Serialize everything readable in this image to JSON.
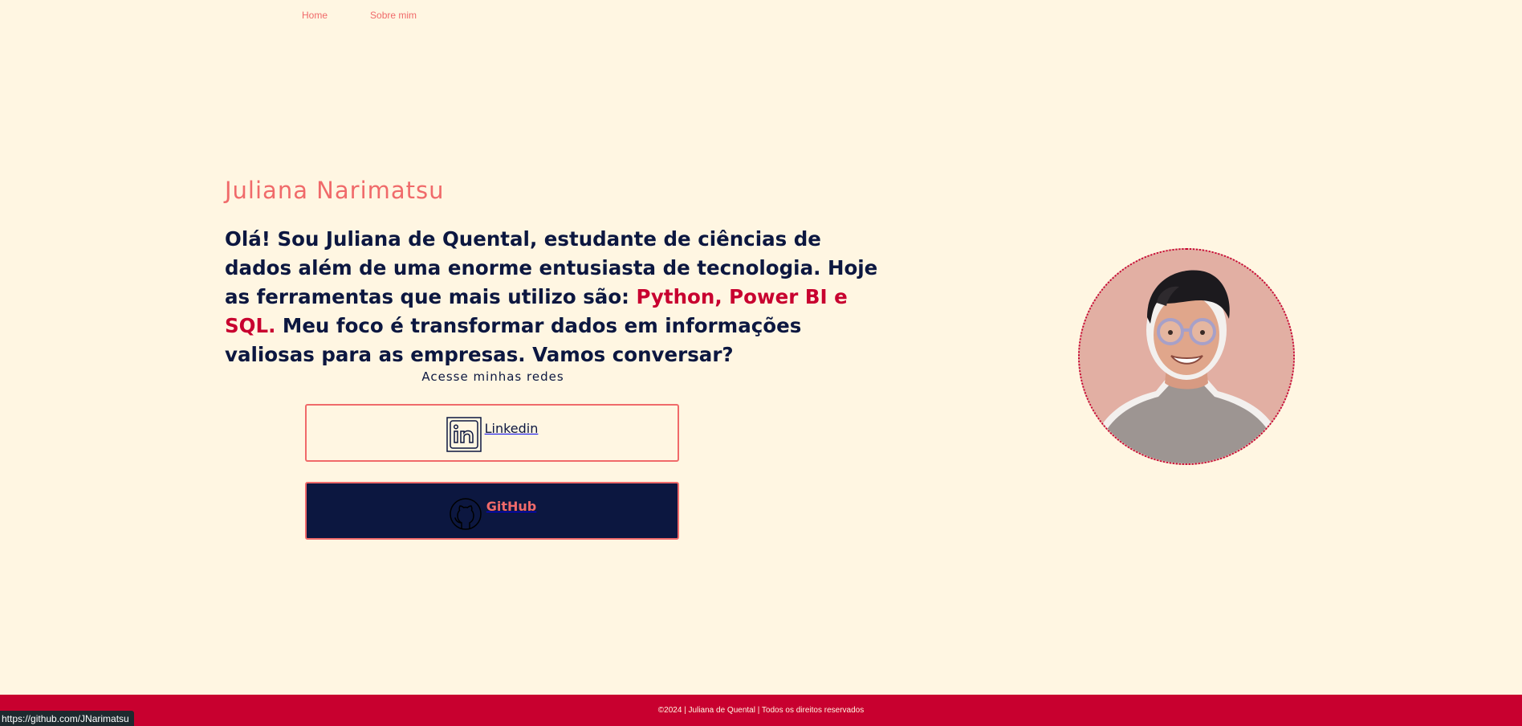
{
  "nav": {
    "home": "Home",
    "about": "Sobre mim"
  },
  "hero": {
    "name": "Juliana Narimatsu",
    "bio_part1": "Olá! Sou Juliana de Quental, estudante de ciências de dados além de uma enorme entusiasta de tecnologia. Hoje as ferramentas que mais utilizo são: ",
    "bio_highlight": "Python, Power BI e SQL.",
    "bio_part2": " Meu foco é transformar dados em informações valiosas para as empresas. Vamos conversar?"
  },
  "social": {
    "title": "Acesse minhas redes",
    "linkedin": {
      "label": "Linkedin",
      "icon": "linkedin-icon"
    },
    "github": {
      "label": "GitHub",
      "icon": "github-icon"
    }
  },
  "footer": {
    "text": "©2024 | Juliana de Quental | Todos os direitos reservados"
  },
  "status_bar": {
    "url": "https://github.com/JNarimatsu"
  },
  "colors": {
    "background": "#FFF6E2",
    "accent": "#F06A6A",
    "navy": "#0C1740",
    "crimson": "#C8002F"
  }
}
